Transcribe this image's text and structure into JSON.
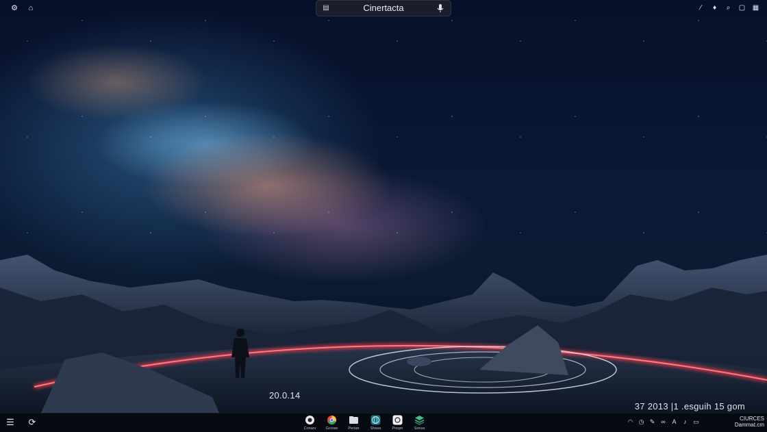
{
  "window": {
    "search_text": "Cinertacta"
  },
  "top_left_icons": [
    "settings-icon",
    "home-icon"
  ],
  "top_right_icons": [
    "pin-icon",
    "notifications-icon",
    "search-icon",
    "window-icon",
    "grid-icon"
  ],
  "overlay": {
    "left_date": "20.0.14",
    "right_text": "37 2013 |1 .esguih 15 gom"
  },
  "taskbar": {
    "apps": [
      {
        "label": "Conarv",
        "icon": "circle-app-icon",
        "color": "#e7e7e7"
      },
      {
        "label": "Gcrose",
        "icon": "chrome-icon",
        "color": "#e8493f"
      },
      {
        "label": "Pertan",
        "icon": "files-icon",
        "color": "#d9dde2"
      },
      {
        "label": "Shasa",
        "icon": "globe-icon",
        "color": "#3fb6c7"
      },
      {
        "label": "Pnopn",
        "icon": "photos-icon",
        "color": "#f0f0f0"
      },
      {
        "label": "Sonsa",
        "icon": "layers-icon",
        "color": "#3fbf8a"
      }
    ],
    "clock_line1": "CIURCES",
    "clock_line2": "Dammat.cm"
  },
  "colors": {
    "accent_ring": "#ff3a4a",
    "taskbar_bg": "#080a10"
  }
}
